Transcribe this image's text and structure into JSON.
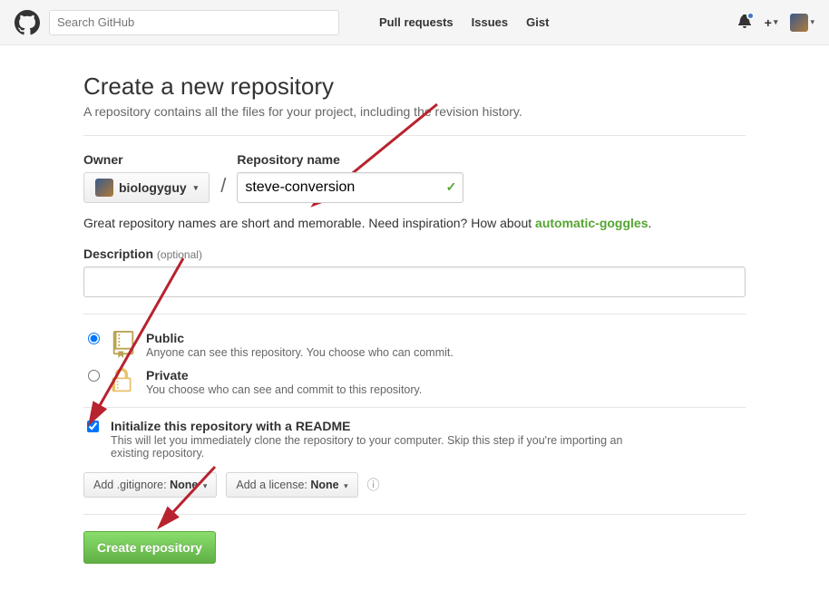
{
  "header": {
    "search_placeholder": "Search GitHub",
    "nav": {
      "pulls": "Pull requests",
      "issues": "Issues",
      "gist": "Gist"
    }
  },
  "page": {
    "title": "Create a new repository",
    "subtitle": "A repository contains all the files for your project, including the revision history.",
    "owner_label": "Owner",
    "owner_name": "biologyguy",
    "name_label": "Repository name",
    "name_value": "steve-conversion",
    "tip_prefix": "Great repository names are short and memorable. Need inspiration? How about ",
    "tip_suggestion": "automatic-goggles",
    "tip_suffix": ".",
    "desc_label": "Description",
    "desc_optional": "(optional)",
    "visibility": {
      "public": {
        "title": "Public",
        "sub": "Anyone can see this repository. You choose who can commit."
      },
      "private": {
        "title": "Private",
        "sub": "You choose who can see and commit to this repository."
      }
    },
    "init": {
      "title": "Initialize this repository with a README",
      "sub": "This will let you immediately clone the repository to your computer. Skip this step if you're importing an existing repository."
    },
    "gitignore_prefix": "Add .gitignore: ",
    "gitignore_value": "None",
    "license_prefix": "Add a license: ",
    "license_value": "None",
    "submit": "Create repository"
  }
}
